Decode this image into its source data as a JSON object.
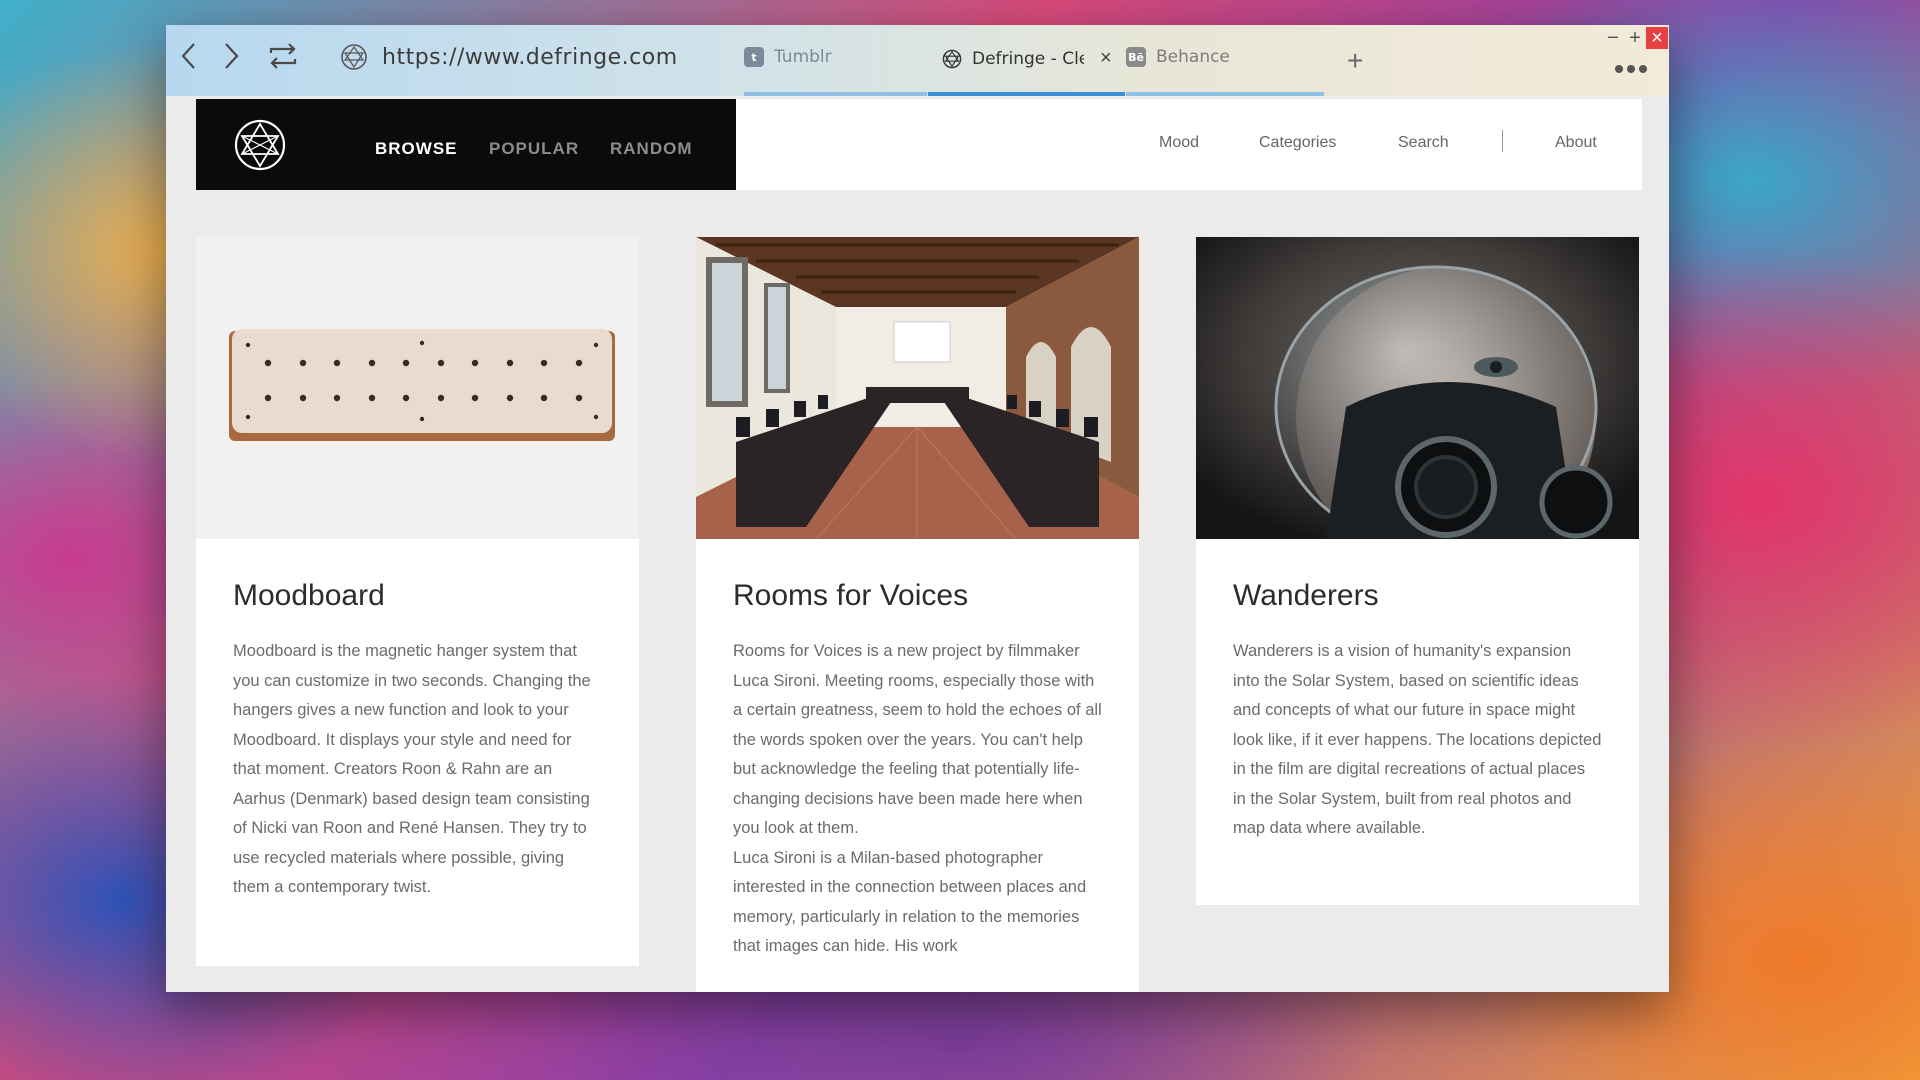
{
  "browser": {
    "url": "https://www.defringe.com",
    "tabs": [
      {
        "label": "Tumblr",
        "favicon": "t",
        "color": "#4a6a8a",
        "active": false,
        "underline_color": "#7fb6e0"
      },
      {
        "label": "Defringe - Cle",
        "active": true,
        "underline_color": "#3a8fd6"
      },
      {
        "label": "Behance",
        "favicon": "Bē",
        "color": "#555555",
        "active": false,
        "underline_color": "#7fb6e0"
      }
    ],
    "new_tab_label": "+",
    "window_controls": {
      "minimize": "−",
      "maximize": "+",
      "close": "×"
    }
  },
  "site": {
    "main_nav": [
      {
        "label": "BROWSE",
        "active": true
      },
      {
        "label": "POPULAR",
        "active": false
      },
      {
        "label": "RANDOM",
        "active": false
      }
    ],
    "secondary_nav": [
      {
        "label": "Mood"
      },
      {
        "label": "Categories"
      },
      {
        "label": "Search"
      },
      {
        "label": "About"
      }
    ]
  },
  "cards": [
    {
      "title": "Moodboard",
      "image": "hanger-board-photo",
      "text": "Moodboard is the magnetic hanger system that you can customize in two seconds. Changing the hangers gives a new function and look to your Moodboard. It displays your style and need for that moment. Creators Roon & Rahn are an Aarhus (Denmark) based design team consisting of Nicki van Roon and René Hansen. They try to use recycled materials where possible, giving them a contemporary twist."
    },
    {
      "title": "Rooms for Voices",
      "image": "meeting-room-photo",
      "text": "Rooms for Voices is a new project by filmmaker Luca Sironi. Meeting rooms, especially those with a certain greatness, seem to hold the echoes of all the words spoken over the years. You can't help but acknowledge the feeling that potentially life-changing decisions have been made here when you look at them.",
      "text2": "Luca Sironi is a Milan-based photographer interested in the connection between places and memory, particularly in relation to the memories that images can hide. His work"
    },
    {
      "title": "Wanderers",
      "image": "astronaut-gas-mask-photo",
      "text": "Wanderers is a vision of humanity's expansion into the Solar System, based on scientific ideas and concepts of what our future in space might look like, if it ever happens. The locations depicted in the film are digital recreations of actual places in the Solar System, built from real photos and map data where available."
    }
  ]
}
